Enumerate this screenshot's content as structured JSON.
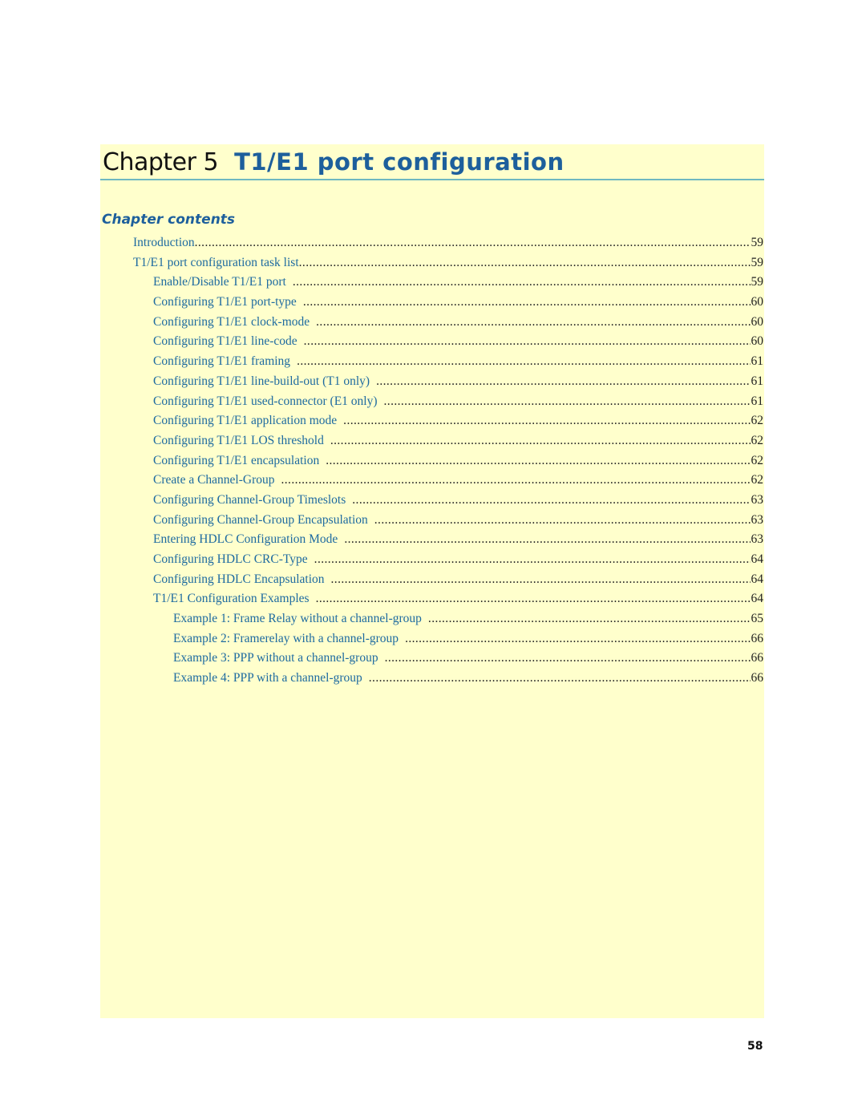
{
  "chapter": {
    "prefix": "Chapter 5",
    "title": "T1/E1 port configuration"
  },
  "colors": {
    "panel_background": "#ffffcc",
    "heading_blue": "#1d5f9c",
    "link_blue": "#1d6aa0",
    "rule_teal": "#6fb8c0"
  },
  "contents_heading": "Chapter contents",
  "toc": [
    {
      "level": 1,
      "label": "Introduction",
      "page": "59"
    },
    {
      "level": 1,
      "label": "T1/E1 port configuration task list",
      "page": "59"
    },
    {
      "level": 2,
      "label": "Enable/Disable T1/E1 port",
      "page": "59"
    },
    {
      "level": 2,
      "label": "Configuring T1/E1 port-type",
      "page": "60"
    },
    {
      "level": 2,
      "label": "Configuring T1/E1 clock-mode",
      "page": "60"
    },
    {
      "level": 2,
      "label": "Configuring T1/E1 line-code",
      "page": "60"
    },
    {
      "level": 2,
      "label": "Configuring T1/E1 framing",
      "page": "61"
    },
    {
      "level": 2,
      "label": "Configuring T1/E1 line-build-out (T1 only)",
      "page": "61"
    },
    {
      "level": 2,
      "label": "Configuring T1/E1 used-connector (E1 only)",
      "page": "61"
    },
    {
      "level": 2,
      "label": "Configuring T1/E1 application mode",
      "page": "62"
    },
    {
      "level": 2,
      "label": "Configuring T1/E1 LOS threshold",
      "page": "62"
    },
    {
      "level": 2,
      "label": "Configuring T1/E1 encapsulation",
      "page": "62"
    },
    {
      "level": 2,
      "label": "Create a Channel-Group",
      "page": "62"
    },
    {
      "level": 2,
      "label": "Configuring Channel-Group Timeslots",
      "page": "63"
    },
    {
      "level": 2,
      "label": "Configuring Channel-Group Encapsulation",
      "page": "63"
    },
    {
      "level": 2,
      "label": "Entering HDLC Configuration Mode",
      "page": "63"
    },
    {
      "level": 2,
      "label": "Configuring HDLC CRC-Type",
      "page": "64"
    },
    {
      "level": 2,
      "label": "Configuring HDLC Encapsulation",
      "page": "64"
    },
    {
      "level": 2,
      "label": "T1/E1 Configuration Examples",
      "page": "64"
    },
    {
      "level": 3,
      "label": "Example 1: Frame Relay without a channel-group",
      "page": "65"
    },
    {
      "level": 3,
      "label": "Example 2: Framerelay with a channel-group",
      "page": "66"
    },
    {
      "level": 3,
      "label": "Example 3: PPP without a channel-group",
      "page": "66"
    },
    {
      "level": 3,
      "label": "Example 4: PPP with a channel-group",
      "page": "66"
    }
  ],
  "page_number": "58"
}
